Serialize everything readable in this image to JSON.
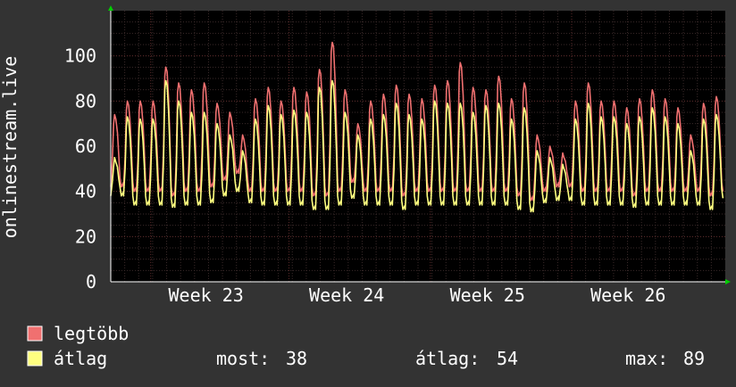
{
  "chart_data": {
    "type": "line",
    "title": "",
    "ylabel": "onlinestream.live",
    "xlabel": "",
    "ylim": [
      0,
      120
    ],
    "yticks": [
      0,
      20,
      40,
      60,
      80,
      100
    ],
    "x_categories": [
      "Week 23",
      "Week 24",
      "Week 25",
      "Week 26"
    ],
    "grid": true,
    "legend_placement": "bottom-left",
    "colors": {
      "background": "#333333",
      "plot_background": "#000000",
      "grid_minor": "#3a2a2a",
      "grid_major": "#5a2a2a",
      "axis_arrow": "#00cc00",
      "text": "#ffffff"
    },
    "series": [
      {
        "name": "legtöbb",
        "color": "#f07070",
        "peaks": [
          74,
          80,
          80,
          80,
          95,
          88,
          85,
          88,
          79,
          75,
          65,
          81,
          86,
          80,
          86,
          84,
          94,
          106,
          85,
          70,
          80,
          83,
          87,
          83,
          81,
          87,
          89,
          97,
          86,
          85,
          91,
          81,
          88,
          65,
          60,
          57,
          80,
          88,
          80,
          80,
          77,
          81,
          85,
          81,
          77,
          65,
          79,
          82
        ],
        "troughs": [
          42,
          40,
          40,
          40,
          38,
          40,
          40,
          42,
          45,
          48,
          40,
          40,
          40,
          40,
          40,
          38,
          38,
          40,
          44,
          40,
          40,
          40,
          38,
          40,
          40,
          40,
          40,
          40,
          40,
          40,
          40,
          38,
          36,
          40,
          42,
          42,
          40,
          40,
          40,
          40,
          38,
          40,
          40,
          40,
          40,
          40,
          38,
          40
        ]
      },
      {
        "name": "átlag",
        "color": "#ffff80",
        "peaks": [
          55,
          73,
          72,
          72,
          89,
          80,
          75,
          75,
          70,
          65,
          58,
          72,
          78,
          74,
          76,
          75,
          86,
          89,
          75,
          65,
          72,
          74,
          79,
          74,
          72,
          80,
          79,
          79,
          75,
          78,
          79,
          72,
          77,
          58,
          55,
          52,
          72,
          79,
          73,
          73,
          70,
          73,
          77,
          73,
          70,
          58,
          72,
          74
        ],
        "troughs": [
          38,
          34,
          34,
          34,
          33,
          34,
          34,
          35,
          38,
          40,
          35,
          34,
          34,
          34,
          34,
          32,
          32,
          34,
          37,
          34,
          34,
          34,
          32,
          34,
          34,
          34,
          34,
          34,
          34,
          34,
          34,
          32,
          31,
          35,
          36,
          36,
          34,
          34,
          34,
          34,
          33,
          34,
          34,
          34,
          34,
          34,
          32,
          37
        ]
      }
    ],
    "legend": [
      {
        "label": "legtöbb",
        "color": "#f07070"
      },
      {
        "label": "átlag",
        "color": "#ffff80"
      }
    ],
    "stats": {
      "now_label": "most:",
      "now_value": "38",
      "avg_label": "átlag:",
      "avg_value": "54",
      "max_label": "max:",
      "max_value": "89"
    }
  }
}
